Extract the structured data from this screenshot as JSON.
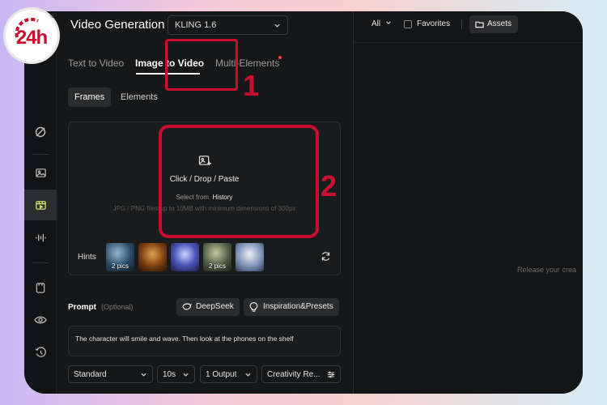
{
  "header": {
    "title": "Video Generation",
    "model": "KLING 1.6"
  },
  "tabs": [
    {
      "label": "Text to Video"
    },
    {
      "label": "Image to Video"
    },
    {
      "label": "Multi-Elements"
    }
  ],
  "subtabs": [
    {
      "label": "Frames"
    },
    {
      "label": "Elements"
    }
  ],
  "upload": {
    "main": "Click / Drop / Paste",
    "select_prefix": "Select from",
    "select_link": "History",
    "note": "JPG / PNG files up to 10MB with minimum dimensions of 300px"
  },
  "hints": {
    "label": "Hints",
    "thumbs": [
      {
        "caption": "2 pics"
      },
      {
        "caption": ""
      },
      {
        "caption": ""
      },
      {
        "caption": "2 pics"
      },
      {
        "caption": ""
      }
    ]
  },
  "prompt": {
    "label": "Prompt",
    "optional": "(Optional)",
    "deepseek": "DeepSeek",
    "inspiration": "Inspiration&Presets",
    "text": "The character will smile and wave. Then look at the phones on the shelf"
  },
  "settings": {
    "mode": "Standard",
    "duration": "10s",
    "outputs": "1 Output",
    "creativity": "Creativity Re..."
  },
  "right": {
    "all": "All",
    "favorites": "Favorites",
    "assets": "Assets",
    "empty": "Release your crea"
  },
  "annotations": {
    "n1": "1",
    "n2": "2"
  },
  "logo": {
    "text": "24h",
    "reg": "®"
  },
  "colors": {
    "accent_lime": "#d9f06a",
    "highlight_red": "#c8102e",
    "panel_bg": "#161718"
  }
}
